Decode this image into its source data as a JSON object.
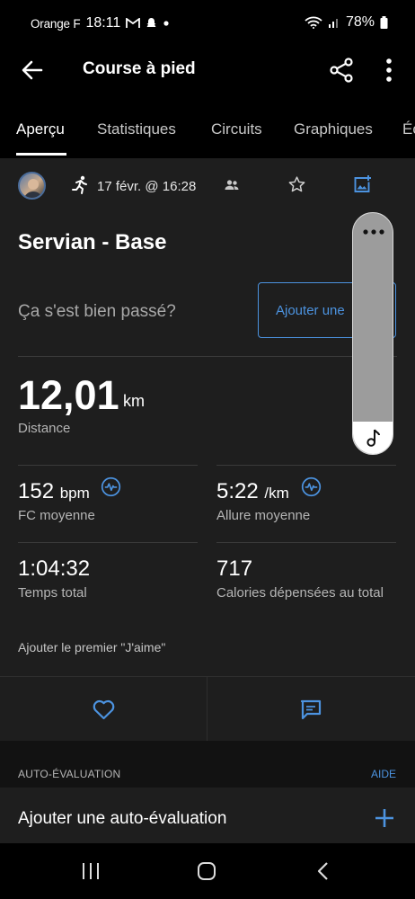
{
  "status_bar": {
    "carrier": "Orange F",
    "time": "18:11",
    "battery": "78%"
  },
  "app_bar": {
    "title": "Course à pied"
  },
  "tabs": [
    {
      "label": "Aperçu",
      "active": true
    },
    {
      "label": "Statistiques",
      "active": false
    },
    {
      "label": "Circuits",
      "active": false
    },
    {
      "label": "Graphiques",
      "active": false
    },
    {
      "label": "Éc",
      "active": false
    }
  ],
  "activity": {
    "date": "17 févr. @ 16:28",
    "title": "Servian - Base"
  },
  "feeling": {
    "question": "Ça s'est bien passé?",
    "button": "Ajouter une"
  },
  "stats": {
    "distance": {
      "value": "12,01",
      "unit": "km",
      "label": "Distance"
    },
    "heart_rate": {
      "value": "152",
      "unit": "bpm",
      "label": "FC moyenne"
    },
    "pace": {
      "value": "5:22",
      "unit": "/km",
      "label": "Allure moyenne"
    },
    "total_time": {
      "value": "1:04:32",
      "label": "Temps total"
    },
    "calories": {
      "value": "717",
      "label": "Calories dépensées au total"
    }
  },
  "likes_prompt": "Ajouter le premier \"J'aime\"",
  "self_evaluation": {
    "section_title": "AUTO-ÉVALUATION",
    "help": "AIDE",
    "add_label": "Ajouter une auto-évaluation"
  },
  "colors": {
    "accent": "#4c93e0",
    "background": "#1e1e1e",
    "bar_background": "#000000"
  }
}
